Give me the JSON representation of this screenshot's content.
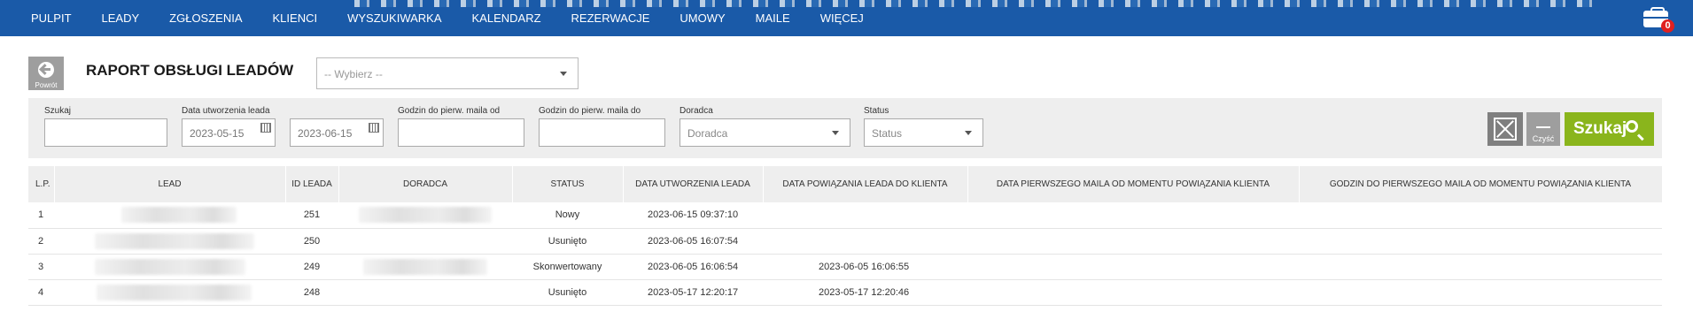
{
  "nav": {
    "items": [
      "PULPIT",
      "LEADY",
      "ZGŁOSZENIA",
      "KLIENCI",
      "WYSZUKIWARKA",
      "KALENDARZ",
      "REZERWACJE",
      "UMOWY",
      "MAILE",
      "WIĘCEJ"
    ],
    "cart_count": "0"
  },
  "header": {
    "back_label": "Powrót",
    "title": "RAPORT OBSŁUGI LEADÓW",
    "report_select_placeholder": "-- Wybierz --"
  },
  "filters": {
    "search_label": "Szukaj",
    "search_value": "",
    "created_label": "Data utworzenia leada",
    "date_from": "2023-05-15",
    "date_to": "2023-06-15",
    "hours_from_label": "Godzin do pierw. maila od",
    "hours_from_value": "",
    "hours_to_label": "Godzin do pierw. maila do",
    "hours_to_value": "",
    "advisor_label": "Doradca",
    "advisor_value": "Doradca",
    "status_label": "Status",
    "status_value": "Status",
    "clear_label": "Czyść",
    "search_button": "Szukaj"
  },
  "table": {
    "columns": [
      "L.P.",
      "LEAD",
      "ID LEADA",
      "DORADCA",
      "STATUS",
      "DATA UTWORZENIA LEADA",
      "DATA POWIĄZANIA LEADA DO KLIENTA",
      "DATA PIERWSZEGO MAILA OD MOMENTU POWIĄZANIA KLIENTA",
      "GODZIN DO PIERWSZEGO MAILA OD MOMENTU POWIĄZANIA KLIENTA"
    ],
    "rows": [
      {
        "lp": "1",
        "id": "251",
        "status": "Nowy",
        "created": "2023-06-15 09:37:10",
        "linked": "",
        "first_mail": "",
        "hours": ""
      },
      {
        "lp": "2",
        "id": "250",
        "status": "Usunięto",
        "created": "2023-06-05 16:07:54",
        "linked": "",
        "first_mail": "",
        "hours": ""
      },
      {
        "lp": "3",
        "id": "249",
        "status": "Skonwertowany",
        "created": "2023-06-05 16:06:54",
        "linked": "2023-06-05 16:06:55",
        "first_mail": "",
        "hours": ""
      },
      {
        "lp": "4",
        "id": "248",
        "status": "Usunięto",
        "created": "2023-05-17 12:20:17",
        "linked": "2023-05-17 12:20:46",
        "first_mail": "",
        "hours": ""
      }
    ]
  }
}
